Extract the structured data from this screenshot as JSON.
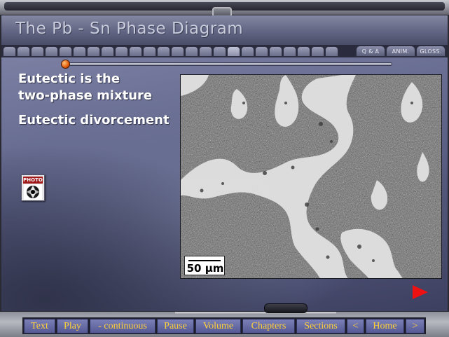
{
  "window": {
    "title": "The Pb - Sn Phase Diagram"
  },
  "tabs": {
    "chapter_tab_count": 24,
    "current_chapter_index": 16,
    "function_tabs": [
      {
        "label": "Q & A"
      },
      {
        "label": "ANIM."
      },
      {
        "label": "GLOSS."
      }
    ]
  },
  "progress": {
    "fraction": 0.01
  },
  "content": {
    "bullets": [
      {
        "lines": [
          "Eutectic is the",
          "two-phase mixture"
        ]
      },
      {
        "lines": [
          "Eutectic divorcement"
        ]
      }
    ],
    "photo_button": {
      "label": "PHOTO",
      "icon": "camera-shutter-icon"
    },
    "micrograph": {
      "scale_bar_label": "50 μm"
    },
    "next_arrow": {
      "icon": "play-right-arrow-icon",
      "color": "#ee1111"
    }
  },
  "nav_bar": {
    "buttons": [
      {
        "label": "Text"
      },
      {
        "label": "Play"
      },
      {
        "label": "- continuous"
      },
      {
        "label": "Pause"
      },
      {
        "label": "Volume"
      },
      {
        "label": "Chapters"
      },
      {
        "label": "Sections"
      },
      {
        "label": "<"
      },
      {
        "label": "Home"
      },
      {
        "label": ">"
      }
    ],
    "text_color": "#ffd23a",
    "button_color": "#6469a6"
  }
}
